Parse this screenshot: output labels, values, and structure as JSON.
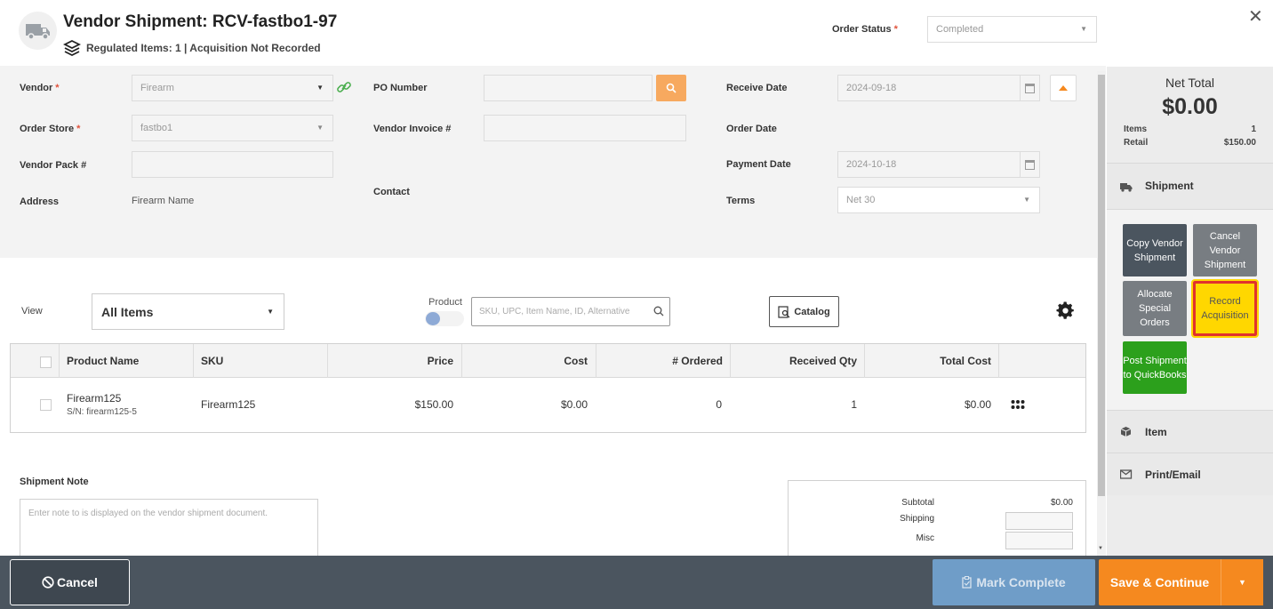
{
  "header": {
    "title": "Vendor Shipment: RCV-fastbo1-97",
    "subtitle": "Regulated Items: 1 | Acquisition Not Recorded",
    "order_status_label": "Order Status",
    "order_status_value": "Completed"
  },
  "form": {
    "vendor_label": "Vendor",
    "vendor_value": "Firearm",
    "order_store_label": "Order Store",
    "order_store_value": "fastbo1",
    "vendor_pack_label": "Vendor Pack #",
    "vendor_pack_value": "",
    "address_label": "Address",
    "address_value": "Firearm Name",
    "po_number_label": "PO Number",
    "po_number_value": "",
    "vendor_invoice_label": "Vendor Invoice #",
    "vendor_invoice_value": "",
    "contact_label": "Contact",
    "receive_date_label": "Receive Date",
    "receive_date_value": "2024-09-18",
    "order_date_label": "Order Date",
    "payment_date_label": "Payment Date",
    "payment_date_value": "2024-10-18",
    "terms_label": "Terms",
    "terms_value": "Net 30"
  },
  "toolbar": {
    "view_label": "View",
    "view_value": "All Items",
    "product_toggle_label": "Product",
    "search_placeholder": "SKU, UPC, Item Name, ID, Alternative",
    "catalog_label": "Catalog"
  },
  "table": {
    "columns": [
      "Product Name",
      "SKU",
      "Price",
      "Cost",
      "# Ordered",
      "Received Qty",
      "Total Cost"
    ],
    "rows": [
      {
        "name": "Firearm125",
        "serial": "S/N: firearm125-5",
        "sku": "Firearm125",
        "price": "$150.00",
        "cost": "$0.00",
        "ordered": "0",
        "received": "1",
        "total": "$0.00"
      }
    ]
  },
  "note": {
    "label": "Shipment Note",
    "placeholder": "Enter note to is displayed on the vendor shipment document."
  },
  "totals": {
    "subtotal_label": "Subtotal",
    "subtotal_value": "$0.00",
    "shipping_label": "Shipping",
    "misc_label": "Misc"
  },
  "side": {
    "net_total_label": "Net Total",
    "net_total_value": "$0.00",
    "items_label": "Items",
    "items_value": "1",
    "retail_label": "Retail",
    "retail_value": "$150.00",
    "shipment_label": "Shipment",
    "copy_btn": "Copy Vendor Shipment",
    "cancel_btn": "Cancel Vendor Shipment",
    "allocate_btn": "Allocate Special Orders",
    "record_btn": "Record Acquisition",
    "post_btn": "Post Shipment to QuickBooks",
    "item_label": "Item",
    "print_label": "Print/Email"
  },
  "footer": {
    "cancel_label": "Cancel",
    "mark_complete_label": "Mark Complete",
    "save_label": "Save & Continue"
  },
  "colors": {
    "accent_orange": "#f5891f",
    "dark_button": "#4b555f",
    "gray_button": "#787d82",
    "highlight_yellow": "#ffd700",
    "highlight_border": "#e0312f",
    "quickbooks_green": "#2ca01c",
    "mark_complete_blue": "#6f9dc8"
  }
}
